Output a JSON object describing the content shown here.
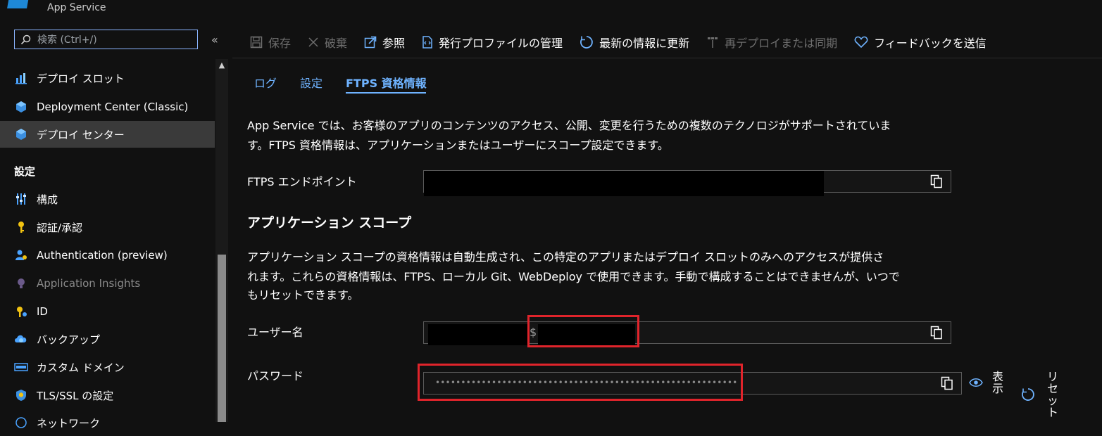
{
  "app": {
    "title": "App Service"
  },
  "search": {
    "placeholder": "検索 (Ctrl+/)"
  },
  "sidebar": {
    "collapse": "«",
    "items": [
      {
        "label": "デプロイ スロット",
        "icon": "deployment-slots-icon"
      },
      {
        "label": "Deployment Center (Classic)",
        "icon": "cube-icon"
      },
      {
        "label": "デプロイ センター",
        "icon": "cube-icon",
        "active": true
      },
      {
        "label": "構成",
        "icon": "sliders-icon"
      },
      {
        "label": "認証/承認",
        "icon": "key-icon"
      },
      {
        "label": "Authentication (preview)",
        "icon": "people-icon"
      },
      {
        "label": "Application Insights",
        "icon": "bulb-icon",
        "disabled": true
      },
      {
        "label": "ID",
        "icon": "identity-icon"
      },
      {
        "label": "バックアップ",
        "icon": "cloud-backup-icon"
      },
      {
        "label": "カスタム ドメイン",
        "icon": "domain-icon"
      },
      {
        "label": "TLS/SSL の設定",
        "icon": "shield-icon"
      },
      {
        "label": "ネットワーク",
        "icon": "network-icon"
      }
    ],
    "section_settings": "設定"
  },
  "toolbar": {
    "save": "保存",
    "discard": "破棄",
    "browse": "参照",
    "manage_profile": "発行プロファイルの管理",
    "refresh": "最新の情報に更新",
    "redeploy": "再デプロイまたは同期",
    "feedback": "フィードバックを送信"
  },
  "tabs": {
    "logs": "ログ",
    "settings": "設定",
    "ftps": "FTPS 資格情報"
  },
  "content": {
    "intro_line1": "App Service では、お客様のアプリのコンテンツのアクセス、公開、変更を行うための複数のテクノロジがサポートされていま",
    "intro_line2": "す。FTPS 資格情報は、アプリケーションまたはユーザーにスコープ設定できます。",
    "ftps_endpoint_label": "FTPS エンドポイント",
    "app_scope_heading": "アプリケーション スコープ",
    "scope_line1": "アプリケーション スコープの資格情報は自動生成され、この特定のアプリまたはデプロイ スロットのみへのアクセスが提供さ",
    "scope_line2": "れます。これらの資格情報は、FTPS、ローカル Git、WebDeploy で使用できます。手動で構成することはできませんが、いつで",
    "scope_line3": "もリセットできます。",
    "username_label": "ユーザー名",
    "username_sep": "$",
    "password_label": "パスワード",
    "password_dots": "••••••••••••••••••••••••••••••••••••••••••••••••••••••••••••",
    "show_label": "表示",
    "reset_label": "リセット"
  },
  "colors": {
    "accent": "#6fb3ff",
    "highlight": "#e0242b",
    "background": "#111111"
  }
}
